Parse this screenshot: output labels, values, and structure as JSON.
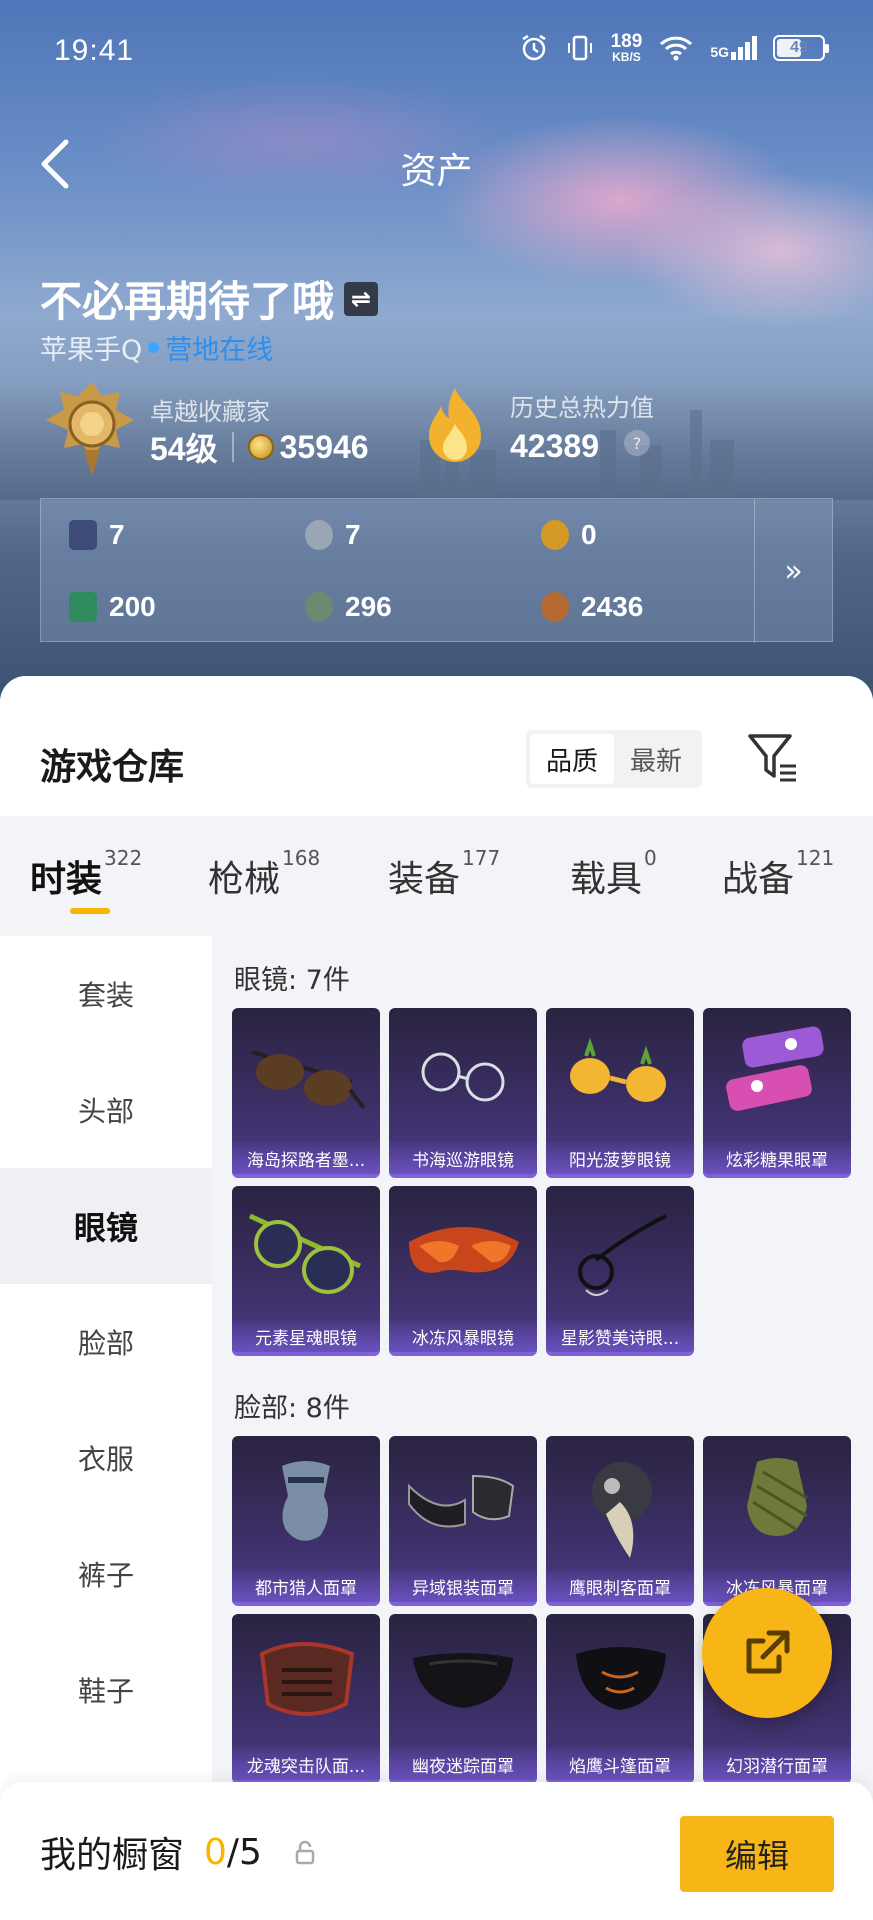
{
  "status_bar": {
    "time": "19:41",
    "net_speed": "189",
    "net_unit": "KB/S",
    "signal": "5G",
    "battery": "49"
  },
  "nav": {
    "title": "资产"
  },
  "profile": {
    "name": "不必再期待了哦",
    "platform": "苹果手Q",
    "online_status": "营地在线",
    "rank_label": "卓越收藏家",
    "level": "54级",
    "coins": "35946",
    "heat_label": "历史总热力值",
    "heat_value": "42389",
    "help": "?"
  },
  "currency": [
    {
      "value": "7",
      "icon": "dark-card-icon",
      "color": "#3c4b78"
    },
    {
      "value": "7",
      "icon": "silver-coin-icon",
      "color": "#9aa6b4"
    },
    {
      "value": "0",
      "icon": "gold-coin-icon",
      "color": "#d59a26"
    },
    {
      "value": "200",
      "icon": "green-card-icon",
      "color": "#2f8a5e"
    },
    {
      "value": "296",
      "icon": "green-coin-icon",
      "color": "#6b8a6f"
    },
    {
      "value": "2436",
      "icon": "bronze-coin-icon",
      "color": "#b46a32"
    }
  ],
  "currency_more": "»",
  "warehouse": {
    "title": "游戏仓库",
    "sort": [
      "品质",
      "最新"
    ],
    "tabs": [
      {
        "label": "时装",
        "count": "322"
      },
      {
        "label": "枪械",
        "count": "168"
      },
      {
        "label": "装备",
        "count": "177"
      },
      {
        "label": "载具",
        "count": "0"
      },
      {
        "label": "战备",
        "count": "121"
      }
    ],
    "categories": [
      "套装",
      "头部",
      "眼镜",
      "脸部",
      "衣服",
      "裤子",
      "鞋子"
    ],
    "sections": [
      {
        "title": "眼镜: 7件",
        "items": [
          "海岛探路者墨...",
          "书海巡游眼镜",
          "阳光菠萝眼镜",
          "炫彩糖果眼罩",
          "元素星魂眼镜",
          "冰冻风暴眼镜",
          "星影赞美诗眼..."
        ]
      },
      {
        "title": "脸部: 8件",
        "items": [
          "都市猎人面罩",
          "异域银装面罩",
          "鹰眼刺客面罩",
          "冰冻风暴面罩",
          "龙魂突击队面...",
          "幽夜迷踪面罩",
          "焰鹰斗篷面罩",
          "幻羽潜行面罩"
        ]
      }
    ]
  },
  "showcase": {
    "label": "我的橱窗",
    "current": "0",
    "total": "/5",
    "edit": "编辑"
  },
  "colors": {
    "accent": "#f8b616",
    "online": "#2c8ff0",
    "card_bg": "#3b2e63"
  }
}
